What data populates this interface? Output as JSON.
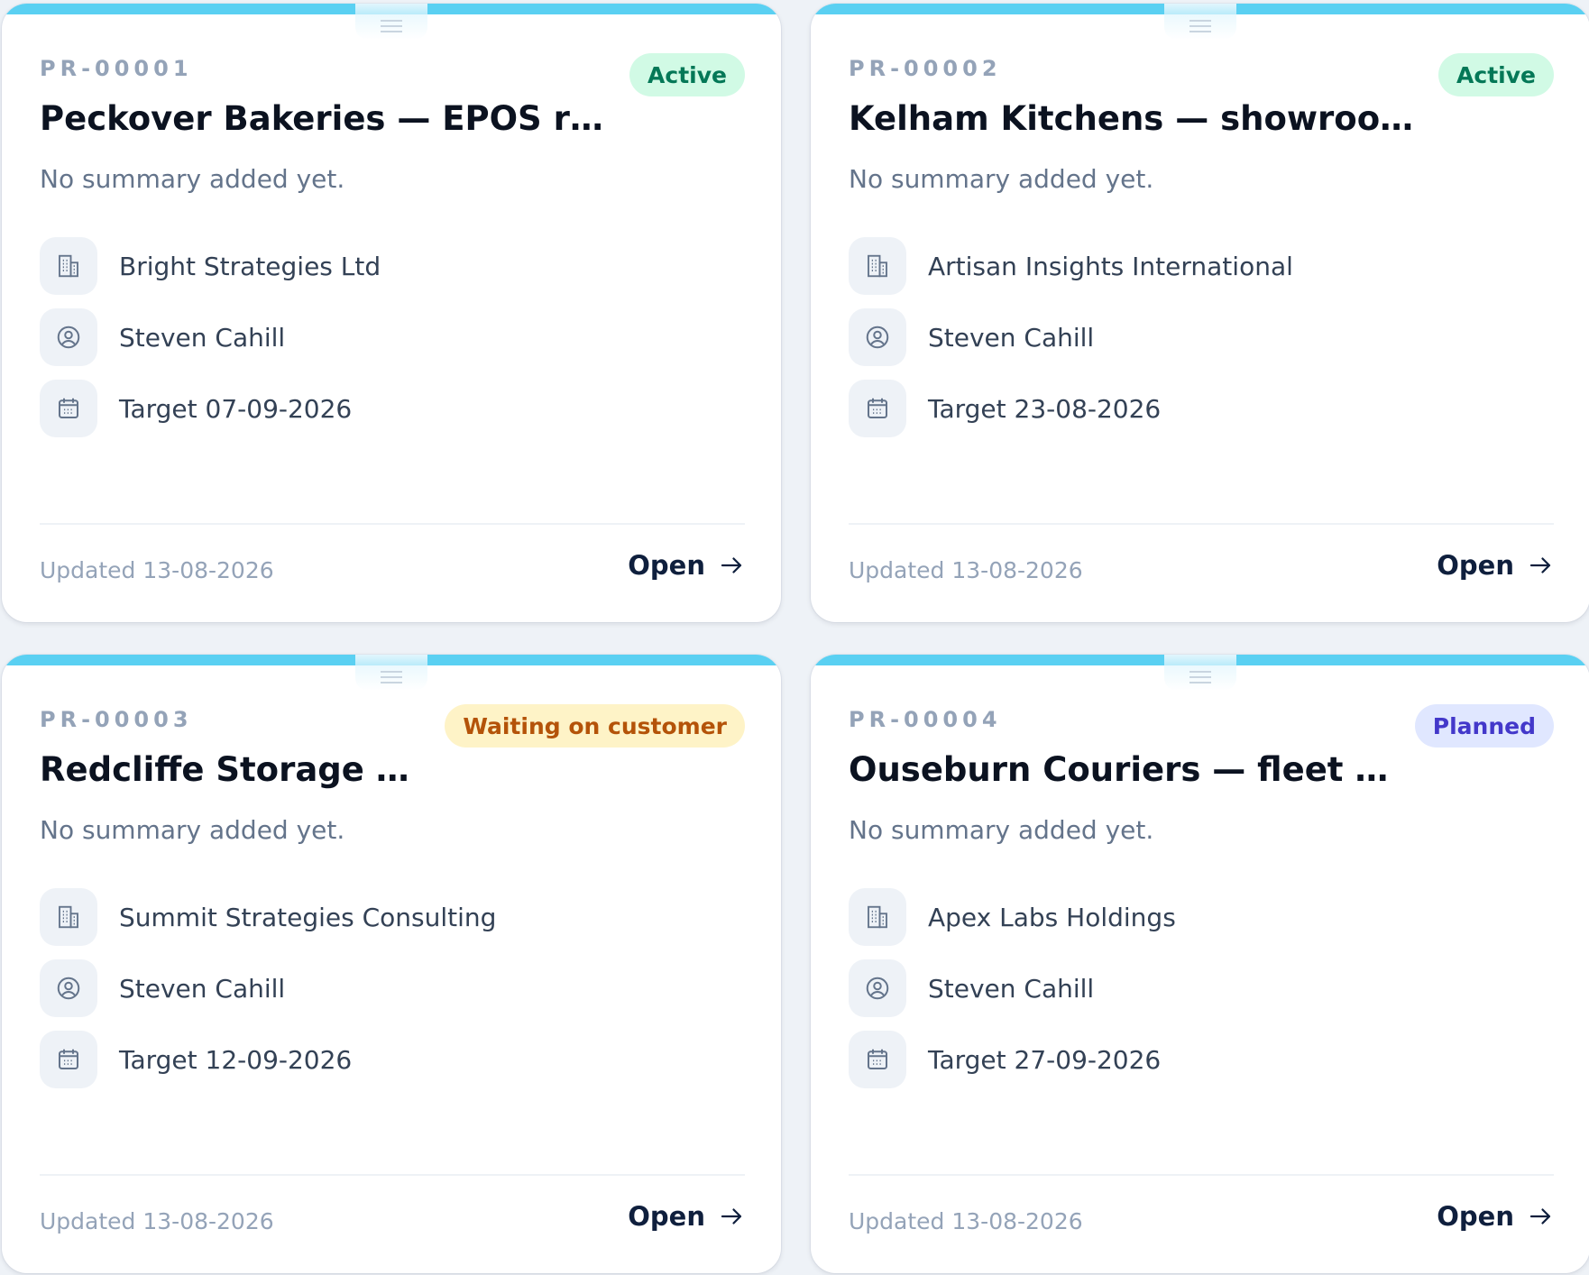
{
  "colors": {
    "accent_bar": "#5ad0f2",
    "active_badge_bg": "#d1fae5",
    "active_badge_text": "#047857",
    "waiting_badge_bg": "#fef3c7",
    "waiting_badge_text": "#b45309",
    "planned_badge_bg": "#e0e7ff",
    "planned_badge_text": "#4338ca"
  },
  "icons": {
    "client": "building-icon",
    "owner": "user-circle-icon",
    "target": "calendar-icon",
    "open": "arrow-right-icon",
    "drag": "drag-handle-icon"
  },
  "projects": [
    {
      "code": "PR-00001",
      "status": "Active",
      "title": "Peckover Bakeries — EPOS r…",
      "summary": "No summary added yet.",
      "client": "Bright Strategies Ltd",
      "owner": "Steven Cahill",
      "target": "Target 07-09-2026",
      "updated": "Updated 13-08-2026",
      "open_label": "Open"
    },
    {
      "code": "PR-00002",
      "status": "Active",
      "title": "Kelham Kitchens — showroo…",
      "summary": "No summary added yet.",
      "client": "Artisan Insights International",
      "owner": "Steven Cahill",
      "target": "Target 23-08-2026",
      "updated": "Updated 13-08-2026",
      "open_label": "Open"
    },
    {
      "code": "PR-00003",
      "status": "Waiting on customer",
      "title": "Redcliffe Storage …",
      "summary": "No summary added yet.",
      "client": "Summit Strategies Consulting",
      "owner": "Steven Cahill",
      "target": "Target 12-09-2026",
      "updated": "Updated 13-08-2026",
      "open_label": "Open"
    },
    {
      "code": "PR-00004",
      "status": "Planned",
      "title": "Ouseburn Couriers — fleet …",
      "summary": "No summary added yet.",
      "client": "Apex Labs Holdings",
      "owner": "Steven Cahill",
      "target": "Target 27-09-2026",
      "updated": "Updated 13-08-2026",
      "open_label": "Open"
    }
  ]
}
